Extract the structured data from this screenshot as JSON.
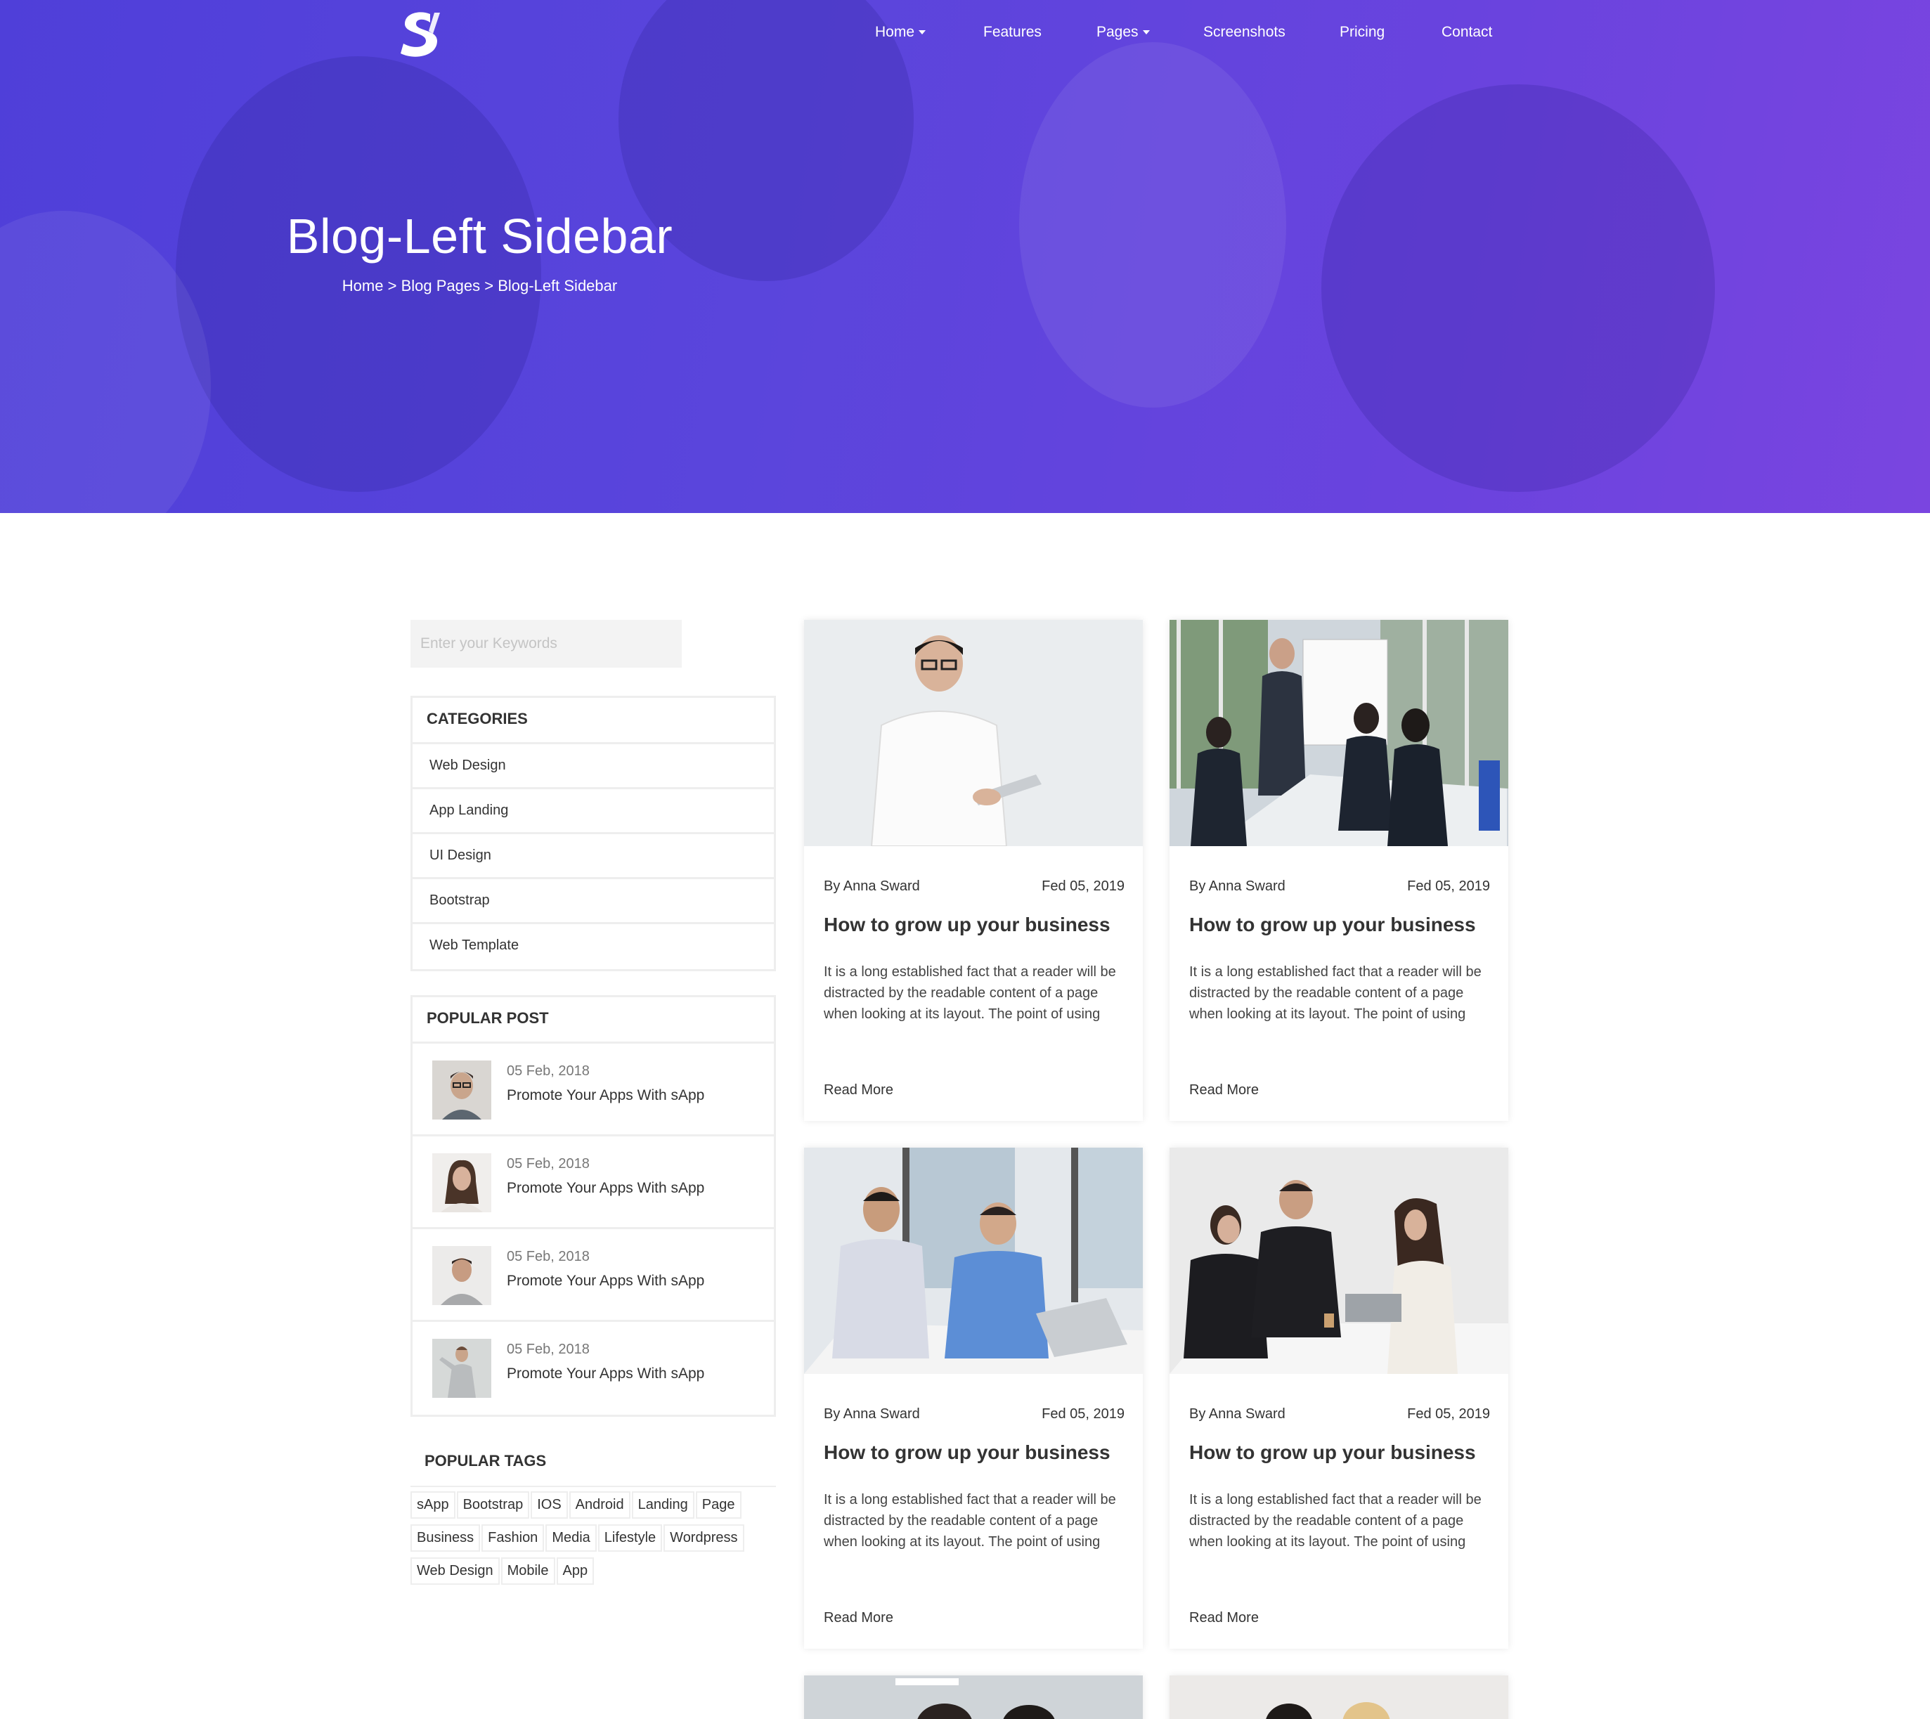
{
  "nav": {
    "items": [
      {
        "label": "Home",
        "dropdown": true
      },
      {
        "label": "Features",
        "dropdown": false
      },
      {
        "label": "Pages",
        "dropdown": true
      },
      {
        "label": "Screenshots",
        "dropdown": false
      },
      {
        "label": "Pricing",
        "dropdown": false
      },
      {
        "label": "Contact",
        "dropdown": false
      }
    ]
  },
  "hero": {
    "title": "Blog-Left Sidebar",
    "breadcrumb": [
      "Home",
      "Blog Pages",
      "Blog-Left Sidebar"
    ],
    "separator": ">",
    "gradient_start": "#4f3fd9",
    "gradient_end": "#7a45e0"
  },
  "search": {
    "placeholder": "Enter your Keywords"
  },
  "categories": {
    "title": "CATEGORIES",
    "items": [
      "Web Design",
      "App Landing",
      "UI Design",
      "Bootstrap",
      "Web Template"
    ]
  },
  "popular_post": {
    "title": "POPULAR POST",
    "items": [
      {
        "date": "05 Feb, 2018",
        "title": "Promote Your Apps With sApp"
      },
      {
        "date": "05 Feb, 2018",
        "title": "Promote Your Apps With sApp"
      },
      {
        "date": "05 Feb, 2018",
        "title": "Promote Your Apps With sApp"
      },
      {
        "date": "05 Feb, 2018",
        "title": "Promote Your Apps With sApp"
      }
    ]
  },
  "popular_tags": {
    "title": "POPULAR TAGS",
    "items": [
      "sApp",
      "Bootstrap",
      "IOS",
      "Android",
      "Landing",
      "Page",
      "Business",
      "Fashion",
      "Media",
      "Lifestyle",
      "Wordpress",
      "Web Design",
      "Mobile",
      "App"
    ]
  },
  "posts": [
    {
      "author": "By Anna Sward",
      "date": "Fed 05, 2019",
      "title": "How to grow up your business",
      "excerpt": "It is a long established fact that a reader will be distracted by the readable content of a page when looking at its layout. The point of using",
      "read_more": "Read More"
    },
    {
      "author": "By Anna Sward",
      "date": "Fed 05, 2019",
      "title": "How to grow up your business",
      "excerpt": "It is a long established fact that a reader will be distracted by the readable content of a page when looking at its layout. The point of using",
      "read_more": "Read More"
    },
    {
      "author": "By Anna Sward",
      "date": "Fed 05, 2019",
      "title": "How to grow up your business",
      "excerpt": "It is a long established fact that a reader will be distracted by the readable content of a page when looking at its layout. The point of using",
      "read_more": "Read More"
    },
    {
      "author": "By Anna Sward",
      "date": "Fed 05, 2019",
      "title": "How to grow up your business",
      "excerpt": "It is a long established fact that a reader will be distracted by the readable content of a page when looking at its layout. The point of using",
      "read_more": "Read More"
    }
  ]
}
